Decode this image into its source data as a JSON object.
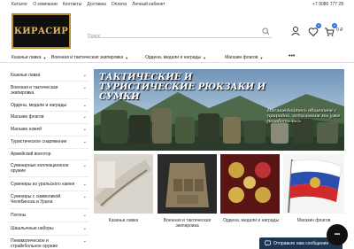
{
  "topbar": {
    "links": [
      "Каталог",
      "О компании",
      "Контакты",
      "Доставка",
      "Оплата",
      "Личный кабинет"
    ],
    "phone": "+7 9080 777 28"
  },
  "header": {
    "logo_text": "КИРАСИР",
    "search_placeholder": "Поиск",
    "favorites_count": "0",
    "cart_count": "0",
    "cart_total": "0 ₽"
  },
  "catnav": {
    "items": [
      "Казачьи лавка",
      "Военная и тактическая экипировка",
      "Ордена, медали и награды",
      "Магазин флагов"
    ],
    "more": "•••"
  },
  "sidebar": {
    "items": [
      "Казачьи лавка",
      "Военная и тактическая экипировка",
      "Ордена, медали и награды",
      "Магазин флагов",
      "Магазин ножей",
      "Туристическое снаряжение",
      "Армейский воентор",
      "Сувенирные коллекционное оружие",
      "Сувениры из уральского камня",
      "Сувениры с символикой Челябинска и Урала",
      "Погоны",
      "Шашлычные наборы",
      "Пневматическое и страйкбольное оружие"
    ]
  },
  "banner": {
    "title": "ТАКТИЧЕСКИЕ И ТУРИСТИЧЕСКИЕ РЮКЗАКИ И СУМКИ",
    "subtitle": "Наслаждайтесь общением с природой, остальным мы уже позаботились"
  },
  "cards": [
    {
      "label": "Казачьи лавка"
    },
    {
      "label": "Военная и тактическая экипировка"
    },
    {
      "label": "Ордена, медали и награды"
    },
    {
      "label": "Магазин флагов"
    }
  ],
  "chat": {
    "message_label": "Отправьте нам сообщение",
    "widget_label": "•••"
  },
  "colors": {
    "accent": "#2f6fd1",
    "logo_gold": "#e0b85a",
    "chat_bar": "#1e3552"
  }
}
